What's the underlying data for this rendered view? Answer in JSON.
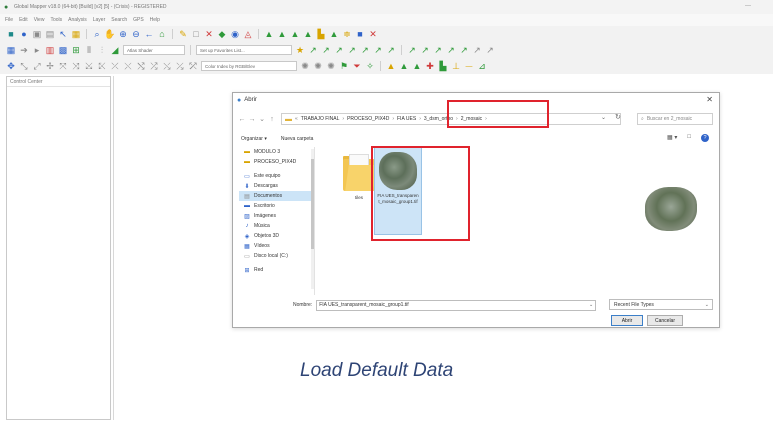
{
  "window": {
    "title": "Global Mapper v18.0 (64-bit) [Build] [v2] [5] - (Crisis) - REGISTERED",
    "minimize": "—"
  },
  "menu": [
    "File",
    "Edit",
    "View",
    "Tools",
    "Analysis",
    "Layer",
    "Search",
    "GPS",
    "Help"
  ],
  "toolbars": {
    "shader_select": "Atlas Shader",
    "favorites_select": "Set up Favorites List...",
    "color_select": "Color Index by RGB/Elev"
  },
  "panel": {
    "title": "Control Center"
  },
  "dialog": {
    "title": "Abrir",
    "close": "✕",
    "path": [
      "TRABAJO FINAL",
      "PROCESO_PIX4D",
      "FIA UES",
      "3_dsm_ortho",
      "2_mosaic"
    ],
    "search_placeholder": "Buscar en 2_mosaic",
    "organize": "Organizar ▾",
    "new_folder": "Nueva carpeta",
    "nav_items": [
      {
        "label": "MODULO 3",
        "icon": "folder-icon"
      },
      {
        "label": "PROCESO_PIX4D",
        "icon": "folder-icon"
      },
      {
        "label": "Este equipo",
        "icon": "computer-icon"
      },
      {
        "label": "Descargas",
        "icon": "download-icon"
      },
      {
        "label": "Documentos",
        "icon": "documents-icon"
      },
      {
        "label": "Escritorio",
        "icon": "desktop-icon"
      },
      {
        "label": "Imágenes",
        "icon": "images-icon"
      },
      {
        "label": "Música",
        "icon": "music-icon"
      },
      {
        "label": "Objetos 3D",
        "icon": "objects-3d-icon"
      },
      {
        "label": "Vídeos",
        "icon": "videos-icon"
      },
      {
        "label": "Disco local (C:)",
        "icon": "drive-icon"
      },
      {
        "label": "Red",
        "icon": "network-icon"
      }
    ],
    "files": [
      {
        "name": "tiles",
        "type": "folder"
      },
      {
        "name": "FIA UES_transparent_mosaic_group1.tif",
        "type": "image"
      }
    ],
    "filename_label": "Nombre:",
    "filename_value": "FIA UES_transparent_mosaic_group1.tif",
    "filetype": "Recent File Types",
    "open_button": "Abrir",
    "cancel_button": "Cancelar"
  },
  "caption": "Load Default Data",
  "colors": {
    "highlight": "#e0232d",
    "caption": "#2e4475",
    "selection": "#cde4f7"
  }
}
